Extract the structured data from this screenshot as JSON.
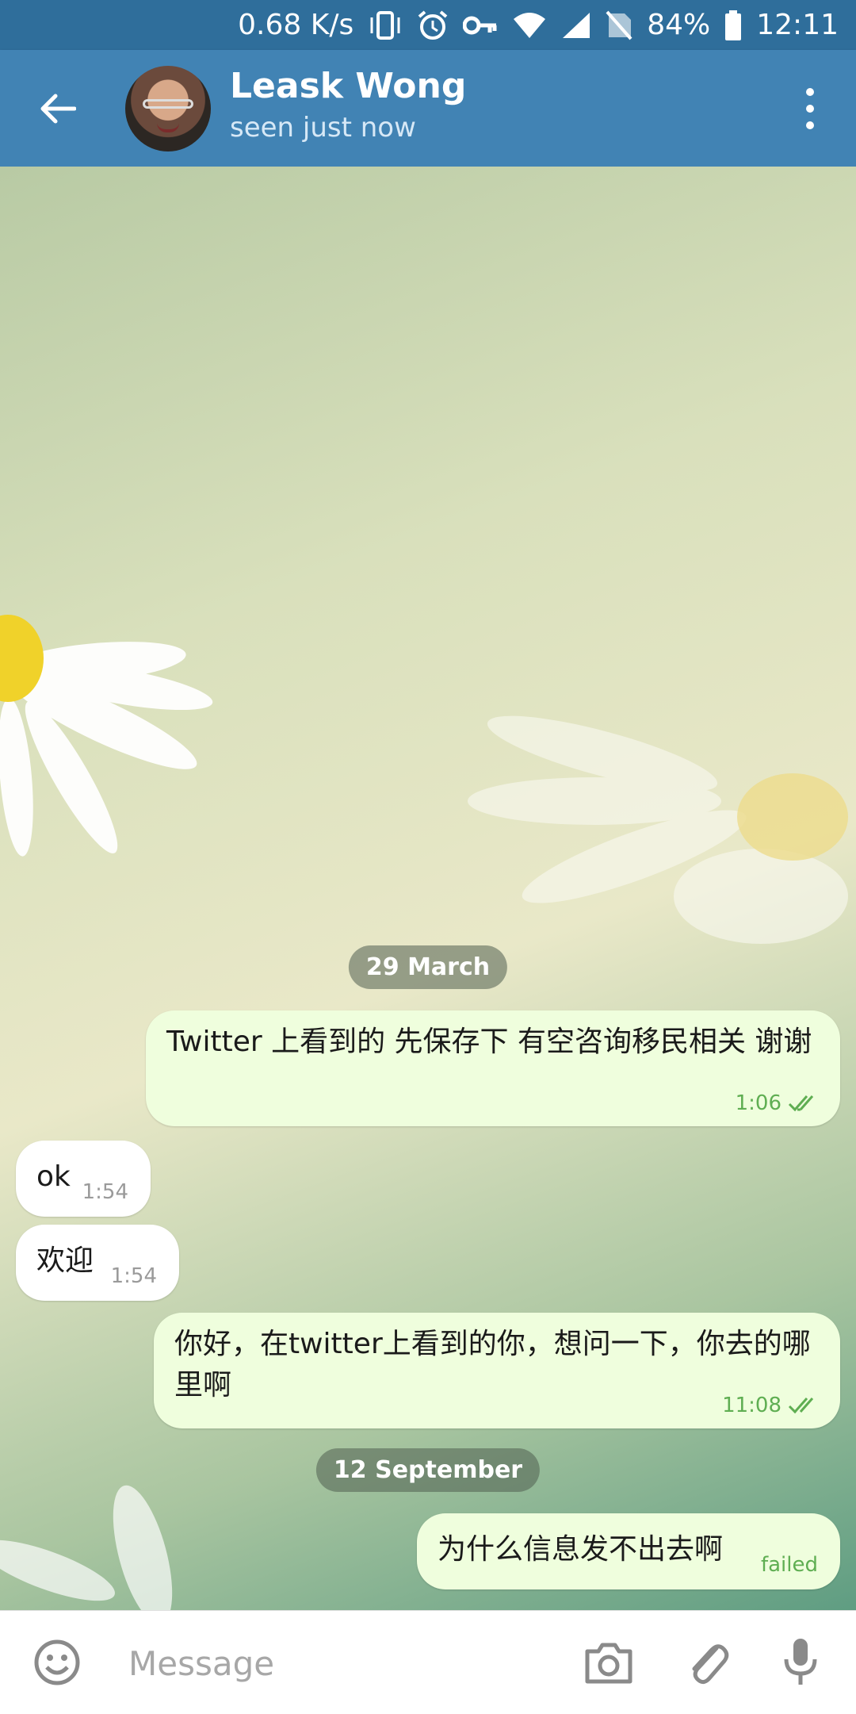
{
  "status_bar": {
    "net_speed": "0.68 K/s",
    "battery": "84%",
    "time": "12:11",
    "icons": [
      "vibrate-icon",
      "alarm-icon",
      "vpn-key-icon",
      "wifi-icon",
      "signal-icon",
      "no-sim-icon",
      "battery-icon"
    ]
  },
  "header": {
    "name": "Leask Wong",
    "status": "seen just now",
    "color": "#4183b4"
  },
  "messages": [
    {
      "kind": "date",
      "text": "29 March"
    },
    {
      "kind": "out",
      "text": "Twitter 上看到的 先保存下 有空咨询移民相关 谢谢",
      "time": "1:06",
      "state": "read"
    },
    {
      "kind": "in",
      "text": "ok",
      "time": "1:54"
    },
    {
      "kind": "in",
      "text": "欢迎",
      "time": "1:54"
    },
    {
      "kind": "out",
      "text": "你好，在twitter上看到的你，想问一下，你去的哪里啊",
      "time": "11:08",
      "state": "read"
    },
    {
      "kind": "date",
      "text": "12 September"
    },
    {
      "kind": "out",
      "text": "为什么信息发不出去啊",
      "time": "failed",
      "state": "failed"
    }
  ],
  "input": {
    "placeholder": "Message"
  },
  "colors": {
    "outgoing_bubble": "#effedd",
    "incoming_bubble": "#ffffff",
    "check_green": "#5fae52"
  }
}
